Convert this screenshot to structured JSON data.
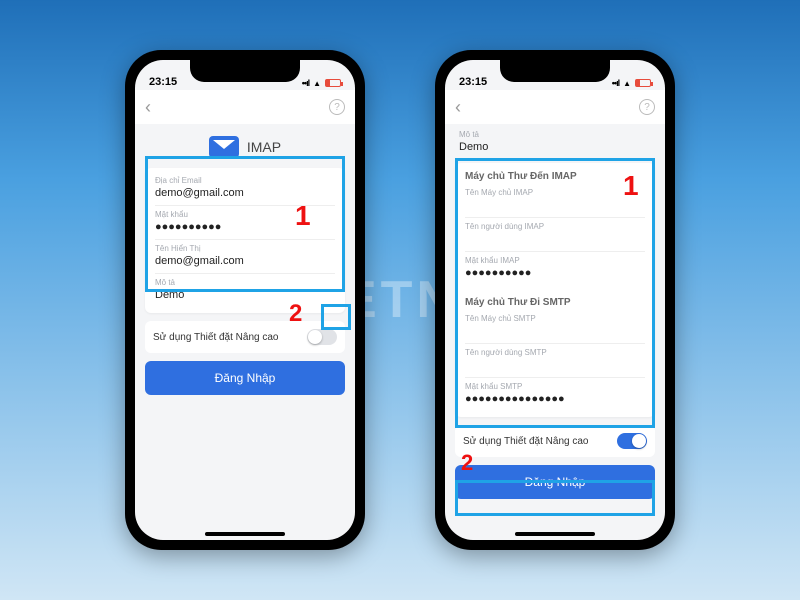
{
  "watermark": "VIETNIX",
  "status": {
    "time": "23:15"
  },
  "nav": {
    "help": "?"
  },
  "left": {
    "brand": "IMAP",
    "fields": {
      "email_label": "Địa chỉ Email",
      "email_value": "demo@gmail.com",
      "password_label": "Mật khẩu",
      "password_value": "●●●●●●●●●●",
      "display_label": "Tên Hiển Thị",
      "display_value": "demo@gmail.com",
      "desc_label": "Mô tả",
      "desc_value": "Demo"
    },
    "advanced_label": "Sử dụng Thiết đặt Nâng cao",
    "login": "Đăng Nhập",
    "ann1": "1",
    "ann2": "2"
  },
  "right": {
    "desc_label": "Mô tả",
    "desc_value": "Demo",
    "imap_section": "Máy chủ Thư Đến IMAP",
    "imap_host_label": "Tên Máy chủ IMAP",
    "imap_user_label": "Tên người dùng IMAP",
    "imap_pass_label": "Mật khẩu IMAP",
    "imap_pass_value": "●●●●●●●●●●",
    "smtp_section": "Máy chủ Thư Đi SMTP",
    "smtp_host_label": "Tên Máy chủ SMTP",
    "smtp_user_label": "Tên người dùng SMTP",
    "smtp_pass_label": "Mật khẩu SMTP",
    "smtp_pass_value": "●●●●●●●●●●●●●●●",
    "advanced_label": "Sử dụng Thiết đặt Nâng cao",
    "login": "Đăng Nhập",
    "ann1": "1",
    "ann2": "2"
  }
}
